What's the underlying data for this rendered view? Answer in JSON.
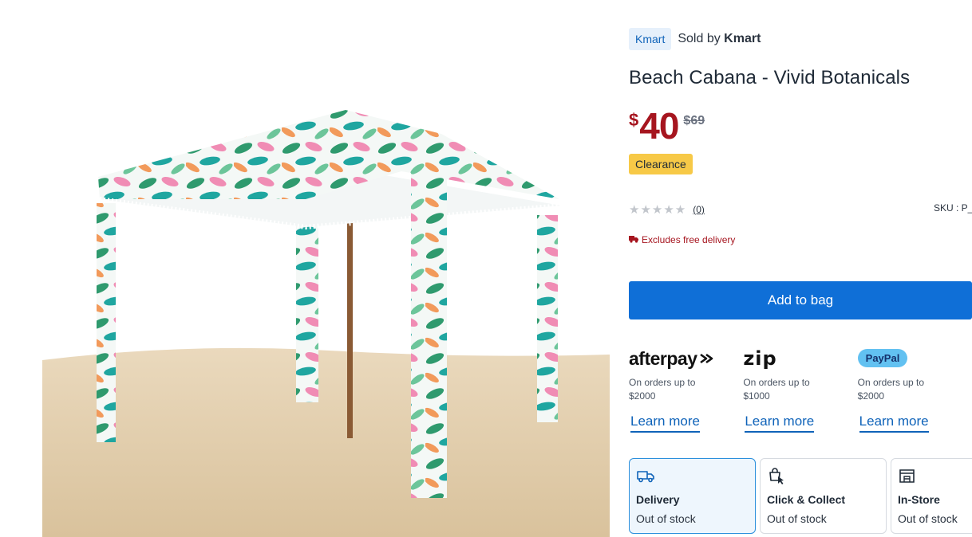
{
  "product": {
    "image_alt": "Beach cabana with vivid botanical print canopy standing on sand",
    "brand": "Kmart",
    "sold_by_prefix": "Sold by",
    "sold_by_name": "Kmart",
    "title": "Beach Cabana - Vivid Botanicals",
    "price_symbol": "$",
    "price": "40",
    "was_price": "$69",
    "badge": "Clearance",
    "rating_stars": "★★★★★",
    "review_count": "(0)",
    "sku": "SKU : P_",
    "delivery_note": "Excludes free delivery"
  },
  "actions": {
    "add_to_bag": "Add to bag"
  },
  "payments": [
    {
      "logo": "afterpay",
      "line1": "On orders up to",
      "line2": "$2000",
      "link": "Learn more"
    },
    {
      "logo": "zip",
      "line1": "On orders up to",
      "line2": "$1000",
      "link": "Learn more"
    },
    {
      "logo": "PayPal",
      "line1": "On orders up to",
      "line2": "$2000",
      "link": "Learn more"
    }
  ],
  "fulfilment": [
    {
      "icon": "delivery-truck-icon",
      "title": "Delivery",
      "status": "Out of stock",
      "selected": true
    },
    {
      "icon": "click-collect-icon",
      "title": "Click & Collect",
      "status": "Out of stock",
      "selected": false
    },
    {
      "icon": "store-icon",
      "title": "In-Store",
      "status": "Out of stock",
      "selected": false
    }
  ],
  "colors": {
    "brand_blue": "#0f6fd7",
    "price_red": "#a6151f",
    "clearance_yellow": "#f7c947",
    "selected_border": "#2a8fdc"
  }
}
